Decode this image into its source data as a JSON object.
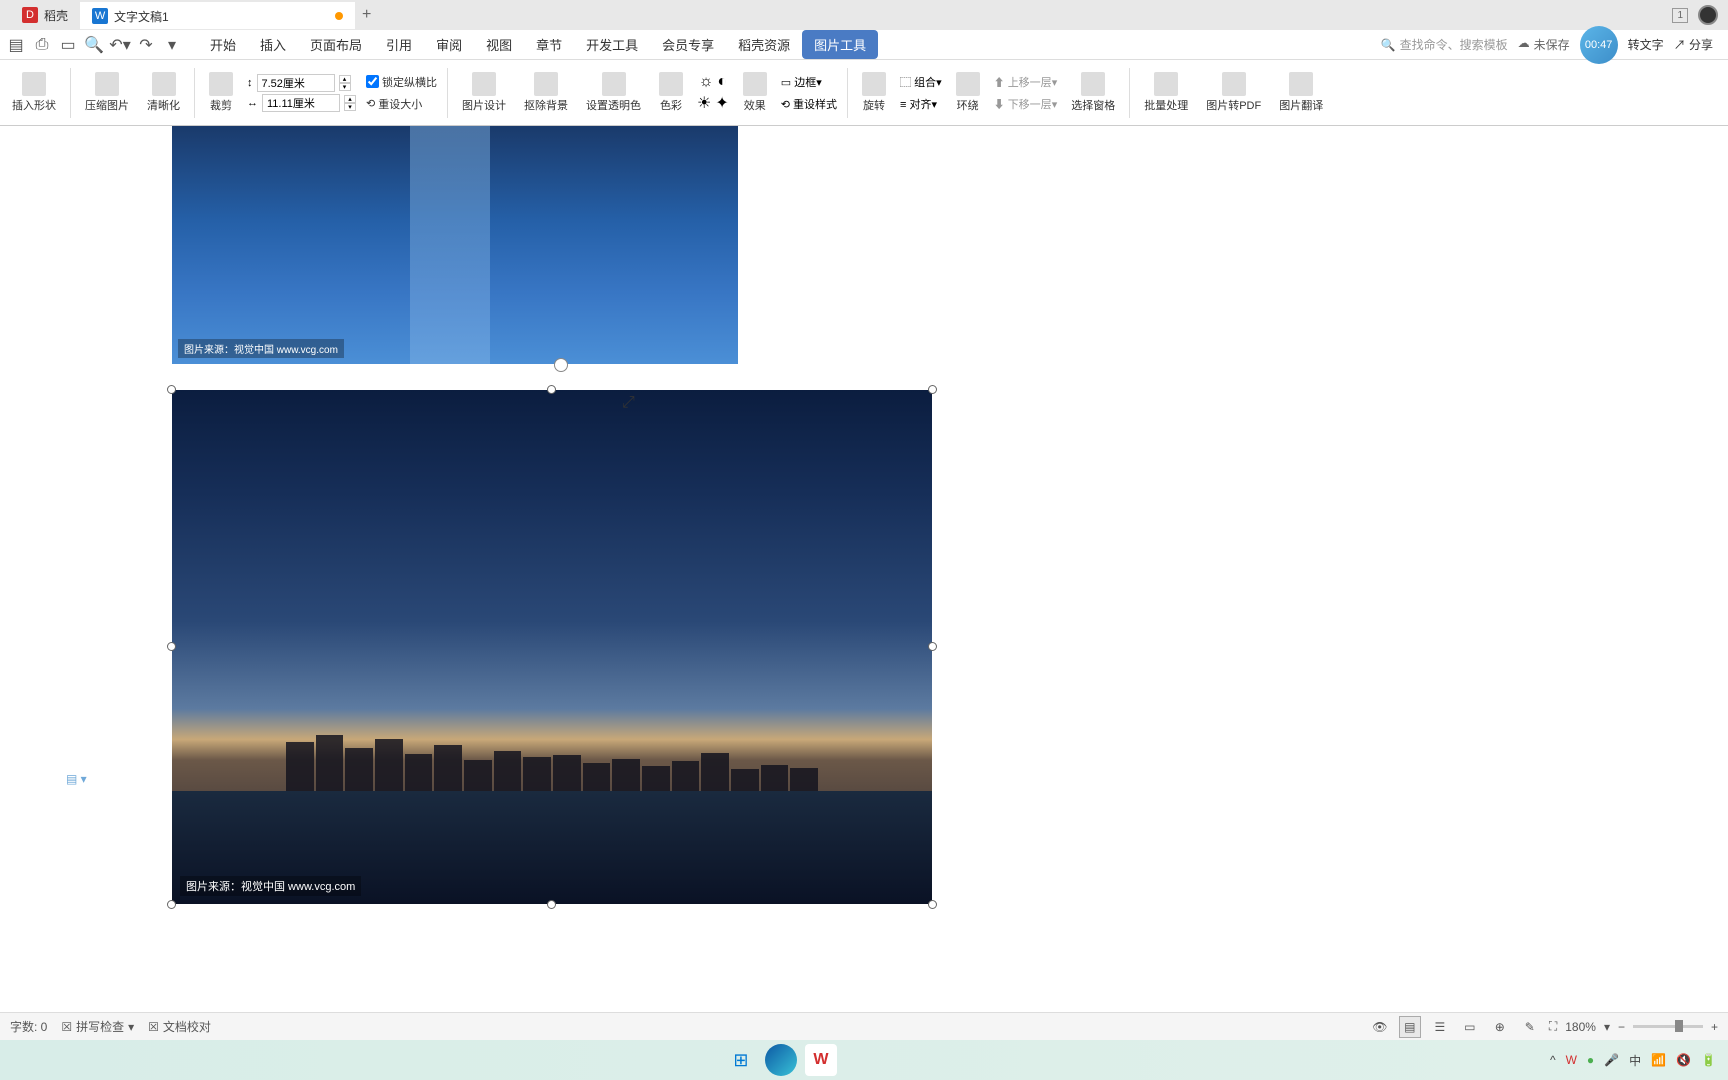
{
  "titlebar": {
    "tab1": "稻壳",
    "tab2": "文字文稿1",
    "win_badge": "1"
  },
  "menubar": {
    "items": [
      "开始",
      "插入",
      "页面布局",
      "引用",
      "审阅",
      "视图",
      "章节",
      "开发工具",
      "会员专享",
      "稻壳资源",
      "图片工具"
    ],
    "search_placeholder": "查找命令、搜索模板",
    "save_status": "未保存",
    "time": "00:47",
    "share": "分享",
    "to_text": "转文字"
  },
  "ribbon": {
    "insert_shape": "插入形状",
    "compress": "压缩图片",
    "clarity": "清晰化",
    "crop": "裁剪",
    "height": "7.52厘米",
    "width": "11.11厘米",
    "lock_ratio": "锁定纵横比",
    "reset_size": "重设大小",
    "pic_design": "图片设计",
    "remove_bg": "抠除背景",
    "set_transparent": "设置透明色",
    "color": "色彩",
    "effect": "效果",
    "border": "边框",
    "reset_style": "重设样式",
    "rotate": "旋转",
    "group": "组合",
    "align": "对齐",
    "wrap": "环绕",
    "move_up": "上移一层",
    "move_down": "下移一层",
    "select_pane": "选择窗格",
    "batch": "批量处理",
    "to_pdf": "图片转PDF",
    "translate": "图片翻译"
  },
  "doc": {
    "watermark1": "图片来源：视觉中国 www.vcg.com",
    "watermark2": "图片来源：视觉中国 www.vcg.com"
  },
  "statusbar": {
    "wordcount": "字数: 0",
    "spellcheck": "拼写检查",
    "proofread": "文档校对",
    "zoom": "180%"
  },
  "taskbar": {
    "ime": "中"
  }
}
